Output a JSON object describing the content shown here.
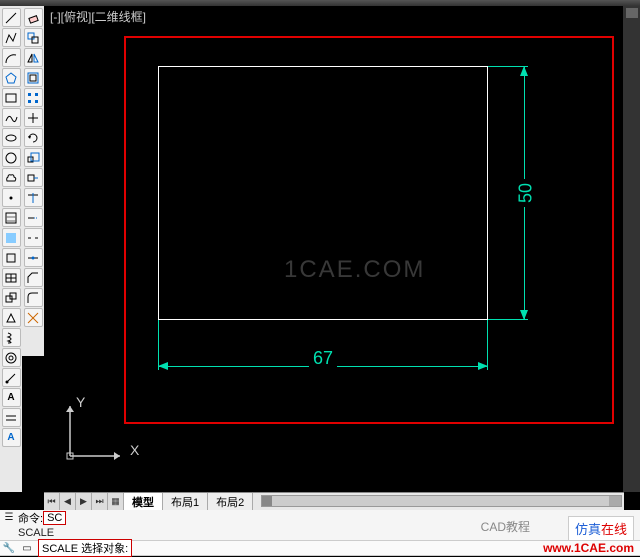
{
  "view_label": "[-][俯视][二维线框]",
  "dimensions": {
    "horizontal": "67",
    "vertical": "50"
  },
  "ucs": {
    "x": "X",
    "y": "Y"
  },
  "watermark": "1CAE.COM",
  "tabs": {
    "model": "模型",
    "layout1": "布局1",
    "layout2": "布局2"
  },
  "command": {
    "prompt1_label": "命令:",
    "prompt1_value": "SC",
    "prompt2": "SCALE",
    "input_value": "SCALE 选择对象:"
  },
  "branding": {
    "cad_tutorial": "CAD教程",
    "sim_online_1": "仿真",
    "sim_online_2": "在线",
    "url": "www.1CAE.com"
  },
  "tool_icons_left": [
    "line",
    "pline",
    "circle",
    "arc",
    "rect",
    "poly",
    "ellipse",
    "spline",
    "hatch",
    "region",
    "point",
    "table",
    "mline",
    "div",
    "ray",
    "xline",
    "donut",
    "revcloud",
    "wipeout",
    "helix",
    "point2",
    "text"
  ],
  "tool_icons_right": [
    "erase",
    "copy",
    "mirror",
    "offset",
    "array",
    "move",
    "rotate",
    "scale",
    "stretch",
    "trim",
    "extend",
    "break",
    "join",
    "chamfer",
    "fillet",
    "explode"
  ]
}
